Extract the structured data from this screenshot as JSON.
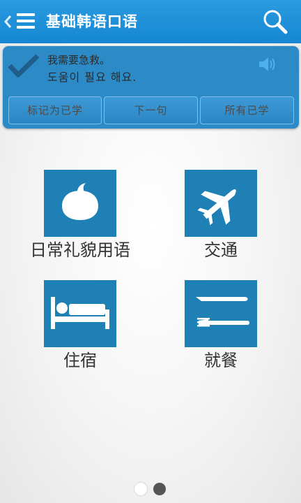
{
  "app_bar": {
    "title": "基础韩语口语",
    "back_icon": "chevron-left-icon",
    "menu_icon": "menu-icon",
    "search_icon": "search-icon",
    "color": "#1a8fd8"
  },
  "phrase_card": {
    "learned_icon": "check-icon",
    "chinese": "我需要急救。",
    "korean": "도움이 필요 해요.",
    "audio_icon": "speaker-icon",
    "buttons": {
      "mark_learned": "标记为已学",
      "next": "下一句",
      "all_learned": "所有已学"
    },
    "color": "#2c8ac6"
  },
  "categories": [
    {
      "label": "日常礼貌用语",
      "icon": "speech-bubble-icon"
    },
    {
      "label": "交通",
      "icon": "airplane-icon"
    },
    {
      "label": "住宿",
      "icon": "bed-icon"
    },
    {
      "label": "就餐",
      "icon": "knife-fork-icon"
    }
  ],
  "tile_color": "#1e80b4",
  "pager": {
    "page_count": 2,
    "current_page": 2
  }
}
